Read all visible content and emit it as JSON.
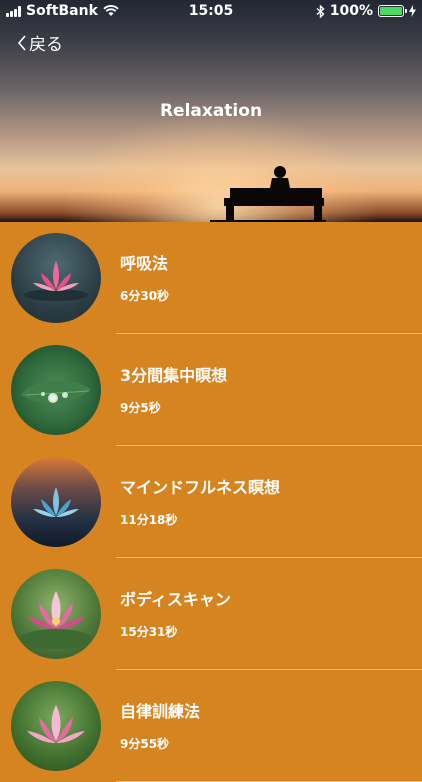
{
  "status_bar": {
    "carrier": "SoftBank",
    "time": "15:05",
    "battery": "100%"
  },
  "nav": {
    "back_label": "戻る"
  },
  "hero": {
    "title": "Relaxation"
  },
  "sessions": [
    {
      "title": "呼吸法",
      "duration": "6分30秒",
      "thumb_icon": "pink-lotus-icon"
    },
    {
      "title": "3分間集中瞑想",
      "duration": "9分5秒",
      "thumb_icon": "water-drop-leaf-icon"
    },
    {
      "title": "マインドフルネス瞑想",
      "duration": "11分18秒",
      "thumb_icon": "blue-lotus-icon"
    },
    {
      "title": "ボディスキャン",
      "duration": "15分31秒",
      "thumb_icon": "pink-lotus-icon"
    },
    {
      "title": "自律訓練法",
      "duration": "9分55秒",
      "thumb_icon": "pink-lotus-icon"
    }
  ]
}
